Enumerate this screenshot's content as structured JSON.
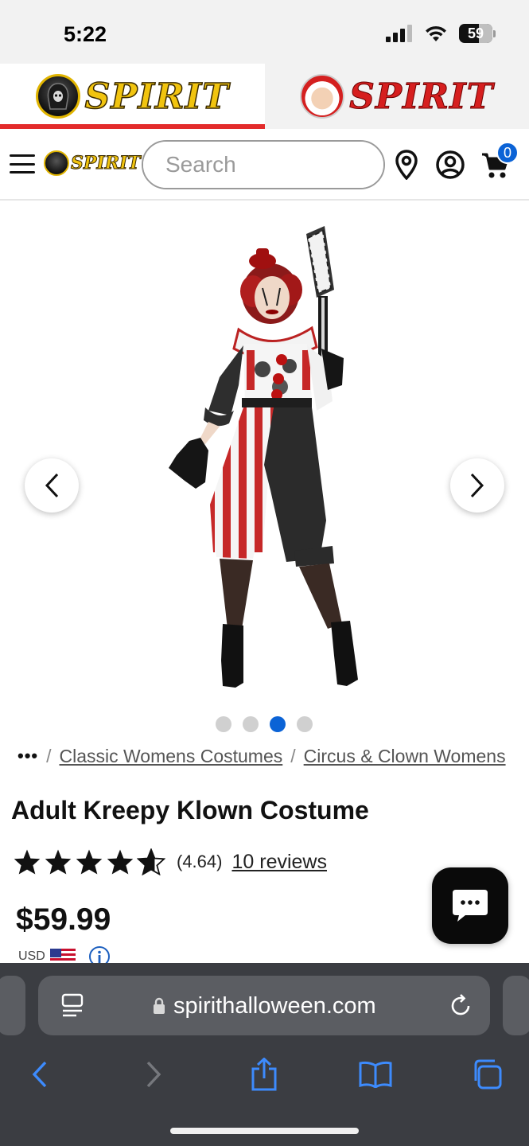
{
  "status": {
    "time": "5:22",
    "battery": "59"
  },
  "brand_tabs": [
    {
      "label": "SPIRIT",
      "active": true
    },
    {
      "label": "SPIRIT",
      "active": false
    }
  ],
  "nav": {
    "logo": "SPIRIT",
    "search_placeholder": "Search",
    "cart_count": "0"
  },
  "gallery": {
    "dots": 4,
    "active_dot": 3
  },
  "breadcrumb": {
    "ellipsis": "•••",
    "items": [
      "Classic Womens Costumes",
      "Circus & Clown Womens"
    ]
  },
  "product": {
    "title": "Adult Kreepy Klown Costume",
    "rating": 4.64,
    "rating_text": "(4.64)",
    "reviews": "10 reviews",
    "price": "$59.99",
    "currency": "USD"
  },
  "browser": {
    "url": "spirithalloween.com"
  },
  "colors": {
    "accent_red": "#e32b2b",
    "brand_blue": "#0b63d6",
    "safari_blue": "#3d8bfd"
  }
}
